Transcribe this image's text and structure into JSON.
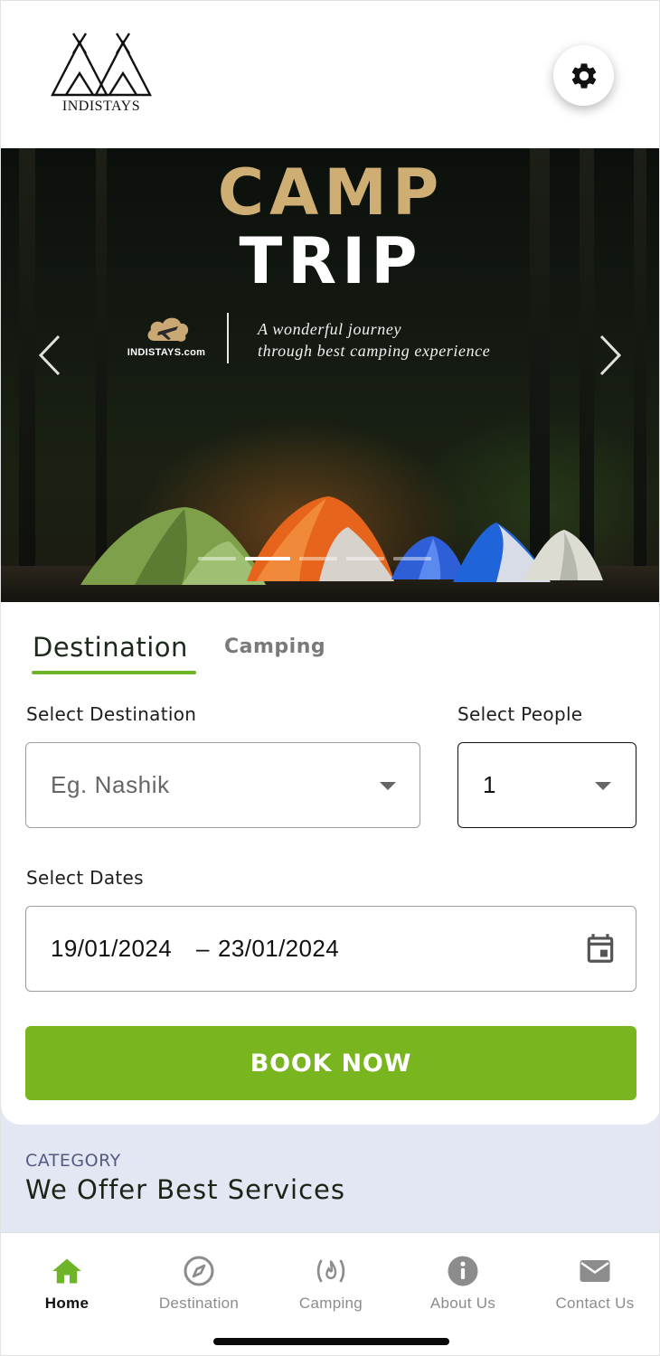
{
  "header": {
    "brand_name": "INDISTAYS",
    "settings_icon": "gear-icon"
  },
  "hero": {
    "title_line1": "CAMP",
    "title_line2": "TRIP",
    "brand_text": "INDISTAYS.com",
    "tagline_line1": "A wonderful journey",
    "tagline_line2": "through best camping experience",
    "slide_count": 5,
    "active_slide": 2,
    "colors": {
      "title_accent": "#cfae74"
    }
  },
  "tabs": [
    {
      "label": "Destination",
      "active": true
    },
    {
      "label": "Camping",
      "active": false
    }
  ],
  "form": {
    "destination_label": "Select Destination",
    "destination_placeholder": "Eg. Nashik",
    "people_label": "Select People",
    "people_value": "1",
    "dates_label": "Select Dates",
    "start_date": "19/01/2024",
    "date_separator": "–",
    "end_date": "23/01/2024",
    "book_button": "BOOK NOW"
  },
  "category": {
    "kicker": "CATEGORY",
    "title": "We Offer Best Services"
  },
  "bottom_nav": [
    {
      "label": "Home",
      "icon": "home-icon",
      "active": true
    },
    {
      "label": "Destination",
      "icon": "compass-icon",
      "active": false
    },
    {
      "label": "Camping",
      "icon": "campfire-icon",
      "active": false
    },
    {
      "label": "About Us",
      "icon": "info-icon",
      "active": false
    },
    {
      "label": "Contact Us",
      "icon": "envelope-icon",
      "active": false
    }
  ],
  "colors": {
    "primary_green": "#78b51e",
    "tab_underline": "#6db527",
    "category_bg": "#e3e6f3"
  }
}
